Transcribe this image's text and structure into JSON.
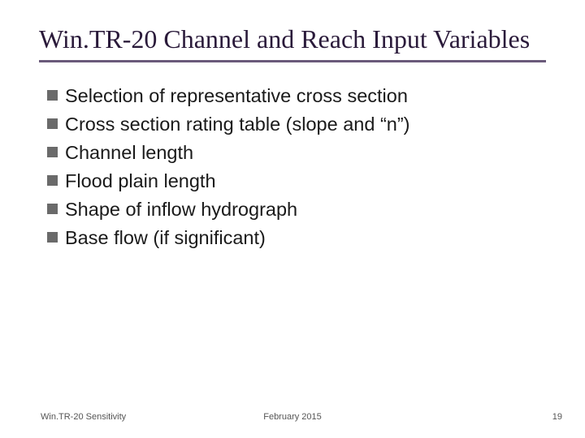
{
  "slide": {
    "title": "Win.TR-20 Channel and Reach Input Variables",
    "bullets": [
      "Selection of representative cross section",
      "Cross section rating table (slope and “n”)",
      "Channel length",
      "Flood plain length",
      "Shape of inflow hydrograph",
      "Base flow (if significant)"
    ]
  },
  "footer": {
    "left": "Win.TR-20 Sensitivity",
    "center": "February 2015",
    "right": "19"
  }
}
